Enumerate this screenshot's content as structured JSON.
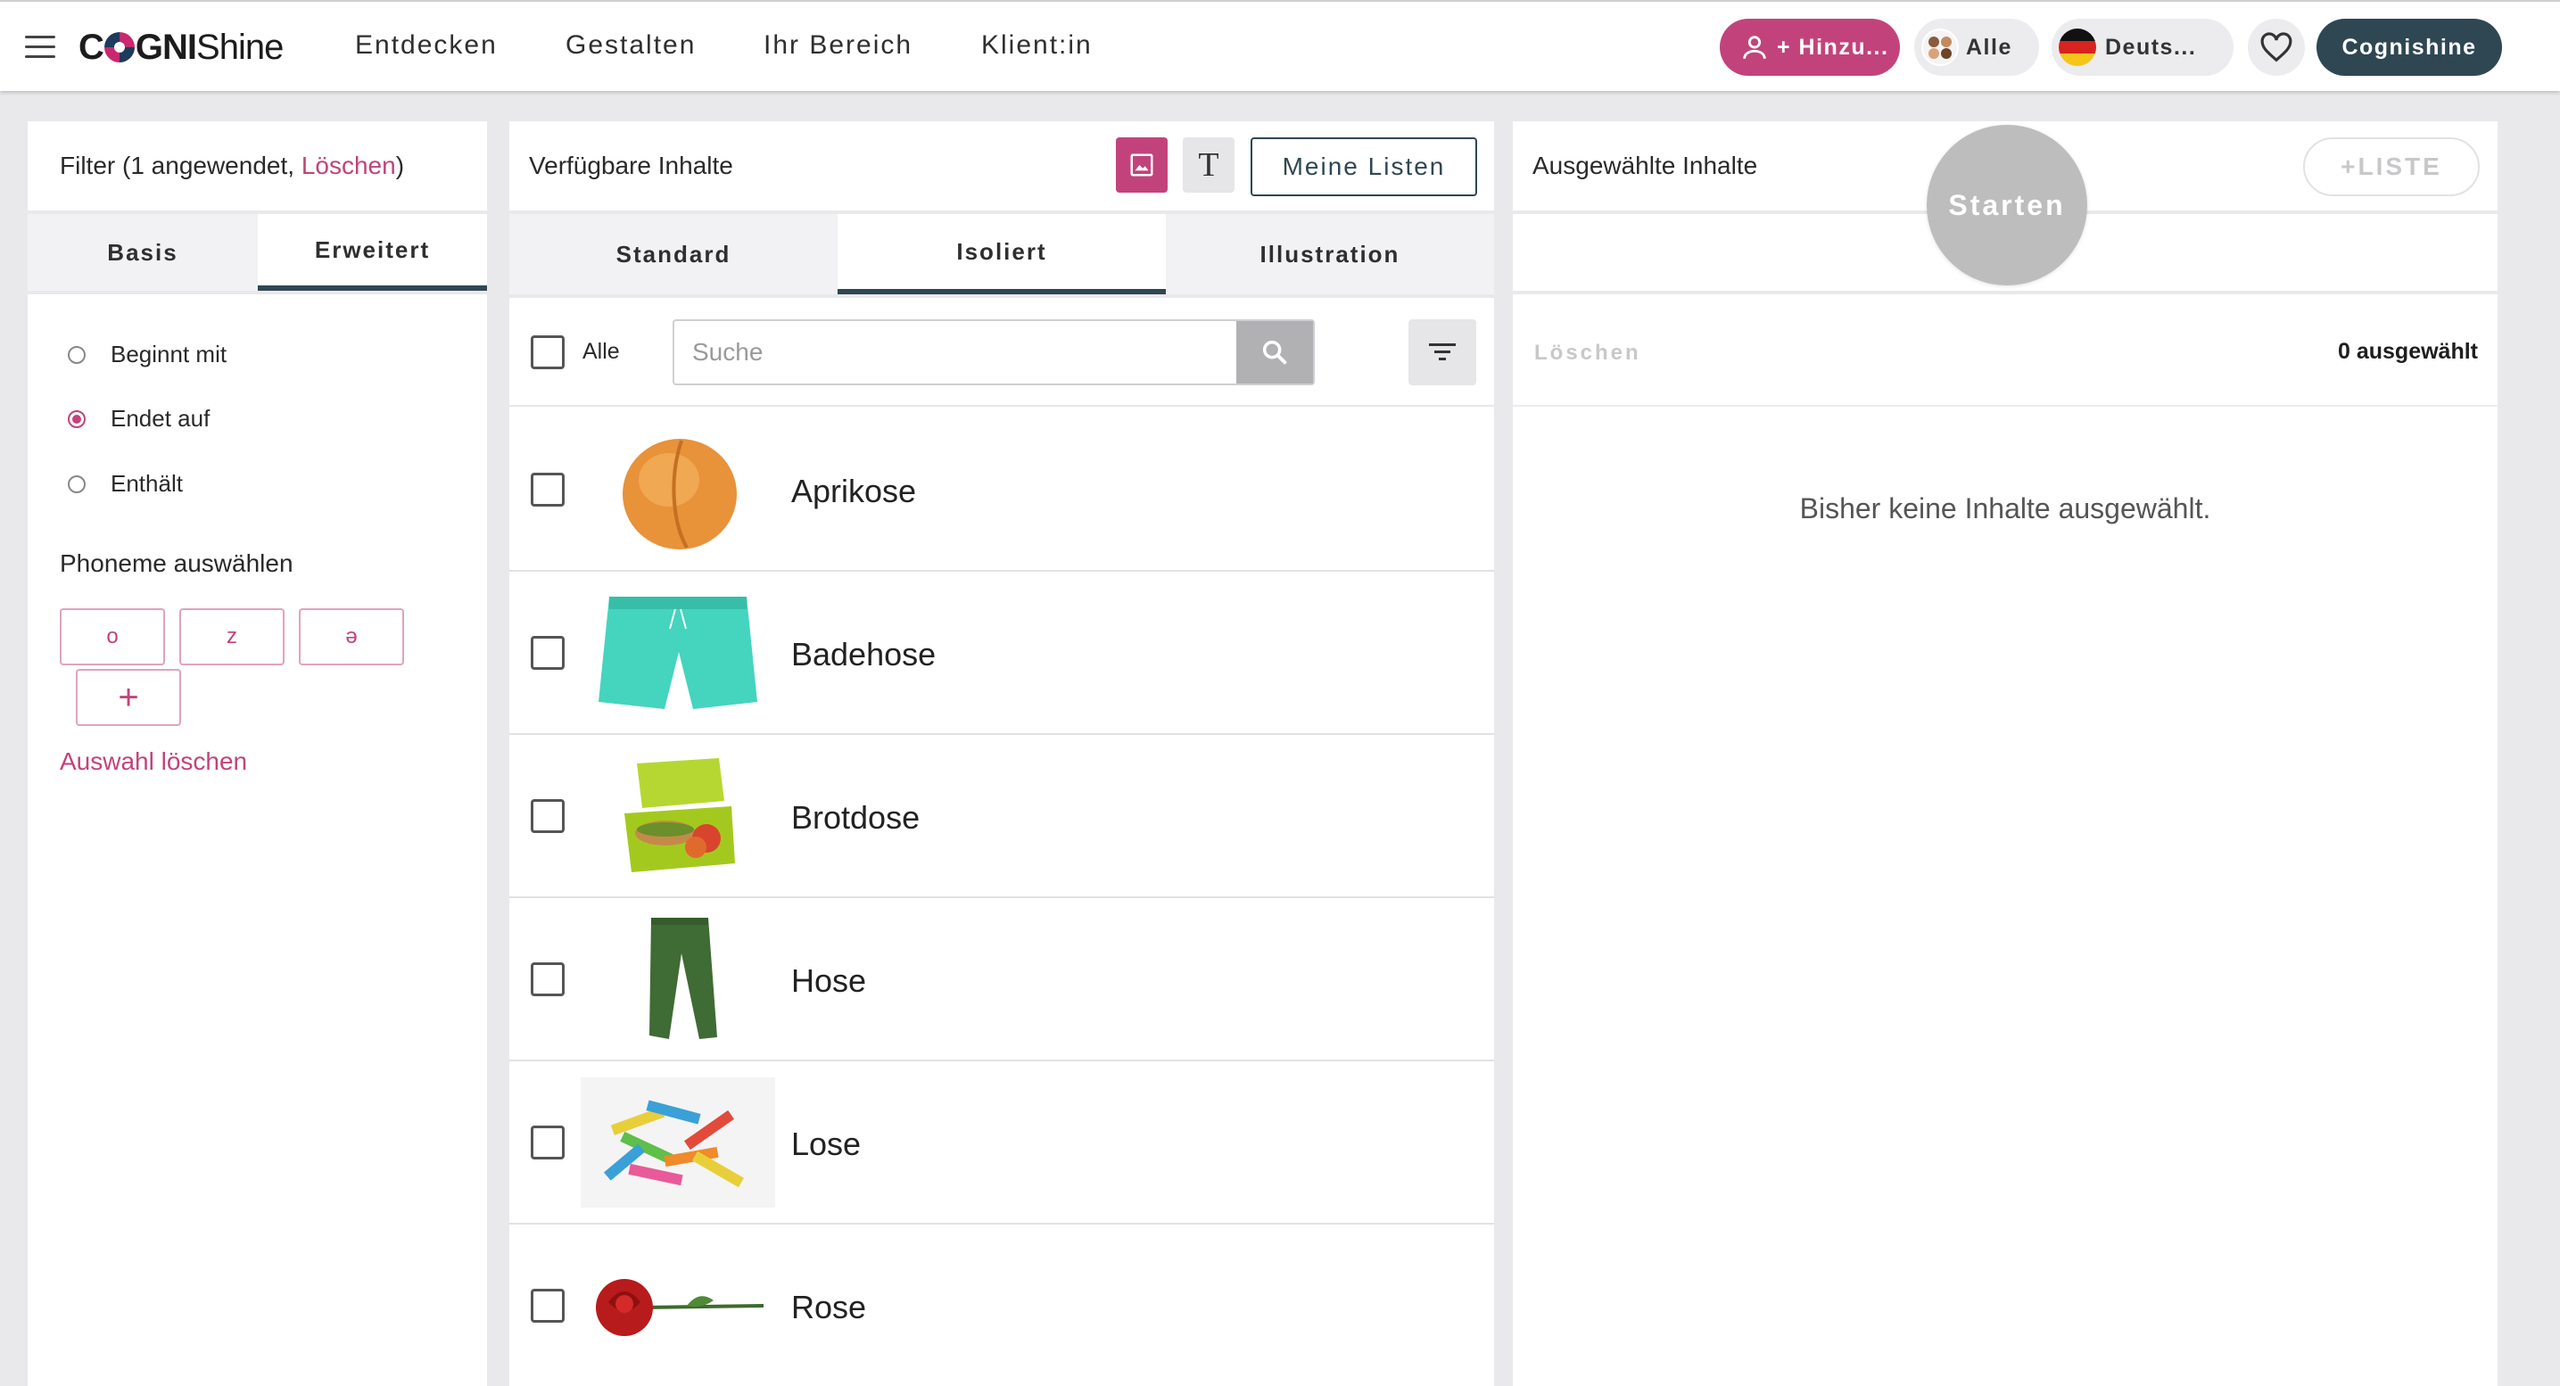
{
  "app": {
    "logo_co": "C",
    "logo_gni": "GNI",
    "logo_shine": "Shine"
  },
  "nav": {
    "items": [
      "Entdecken",
      "Gestalten",
      "Ihr Bereich",
      "Klient:in"
    ]
  },
  "header_actions": {
    "add_client_label": "+ Hinzu...",
    "group_label": "Alle",
    "language_label": "Deuts...",
    "user_label": "Cognishine",
    "icons": [
      "person-add-icon",
      "group-avatar-icon",
      "german-flag-icon",
      "heart-icon"
    ]
  },
  "filter": {
    "title_prefix": "Filter (1 angewendet, ",
    "title_clear": "Löschen",
    "title_suffix": ")",
    "tabs": [
      "Basis",
      "Erweitert"
    ],
    "active_tab": "Erweitert",
    "options": [
      {
        "label": "Beginnt mit",
        "checked": false
      },
      {
        "label": "Endet auf",
        "checked": true
      },
      {
        "label": "Enthält",
        "checked": false
      }
    ],
    "phoneme_heading": "Phoneme auswählen",
    "phonemes": [
      "o",
      "z",
      "ə"
    ],
    "add_symbol": "+",
    "clear_selection": "Auswahl löschen"
  },
  "available": {
    "title": "Verfügbare Inhalte",
    "text_mode_glyph": "T",
    "my_lists_label": "Meine Listen",
    "tabs": [
      "Standard",
      "Isoliert",
      "Illustration"
    ],
    "active_tab": "Isoliert",
    "select_all_label": "Alle",
    "search_placeholder": "Suche",
    "items": [
      {
        "label": "Aprikose",
        "icon": "apricot-image"
      },
      {
        "label": "Badehose",
        "icon": "swim-shorts-image"
      },
      {
        "label": "Brotdose",
        "icon": "lunchbox-image"
      },
      {
        "label": "Hose",
        "icon": "trousers-image"
      },
      {
        "label": "Lose",
        "icon": "raffle-tickets-image"
      },
      {
        "label": "Rose",
        "icon": "rose-image"
      }
    ]
  },
  "selected": {
    "title": "Ausgewählte Inhalte",
    "add_list_label": "+LISTE",
    "start_label": "Starten",
    "clear_label": "Löschen",
    "count_label": "0 ausgewählt",
    "empty_message": "Bisher keine Inhalte ausgewählt."
  },
  "colors": {
    "accent": "#c2437b",
    "dark": "#2f4753",
    "disabled": "#bdbdbe"
  }
}
